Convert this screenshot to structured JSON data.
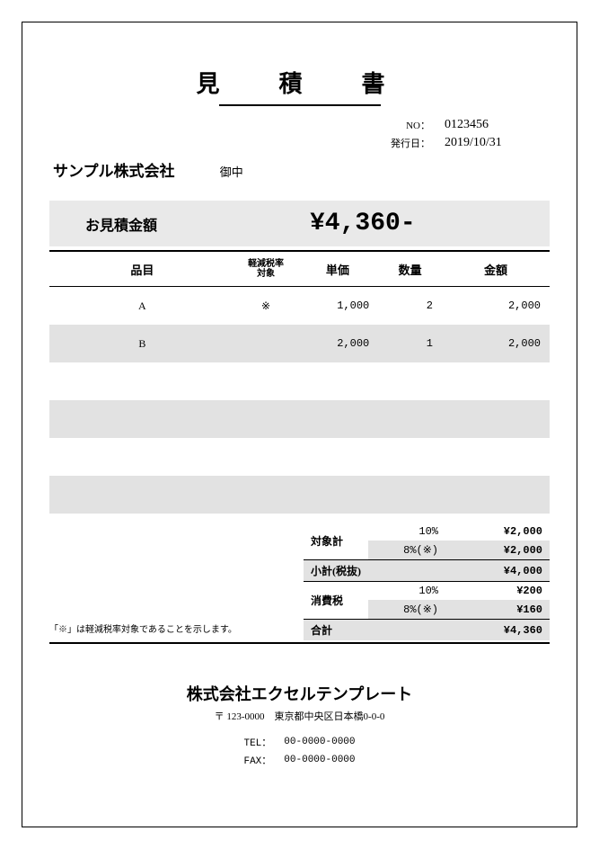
{
  "title": "見　積　書",
  "meta": {
    "no_label": "NO：",
    "no_value": "0123456",
    "date_label": "発行日：",
    "date_value": "2019/10/31"
  },
  "client": {
    "name": "サンプル株式会社",
    "suffix": "御中"
  },
  "quote_total": {
    "label": "お見積金額",
    "value": "¥4,360-"
  },
  "columns": {
    "item": "品目",
    "reduced": "軽減税率\n対象",
    "unit": "単価",
    "qty": "数量",
    "amount": "金額"
  },
  "rows": [
    {
      "item": "A",
      "reduced": "※",
      "unit": "1,000",
      "qty": "2",
      "amount": "2,000"
    },
    {
      "item": "B",
      "reduced": "",
      "unit": "2,000",
      "qty": "1",
      "amount": "2,000"
    },
    {
      "item": "",
      "reduced": "",
      "unit": "",
      "qty": "",
      "amount": ""
    },
    {
      "item": "",
      "reduced": "",
      "unit": "",
      "qty": "",
      "amount": ""
    },
    {
      "item": "",
      "reduced": "",
      "unit": "",
      "qty": "",
      "amount": ""
    },
    {
      "item": "",
      "reduced": "",
      "unit": "",
      "qty": "",
      "amount": ""
    }
  ],
  "note": "「※」は軽減税率対象であることを示します。",
  "summary": {
    "subtotal_label": "対象計",
    "sub10_rate": "10%",
    "sub10_amt": "¥2,000",
    "sub8_rate": "8%(※)",
    "sub8_amt": "¥2,000",
    "exsubtotal_label": "小計(税抜)",
    "exsubtotal_amt": "¥4,000",
    "tax_label": "消費税",
    "tax10_rate": "10%",
    "tax10_amt": "¥200",
    "tax8_rate": "8%(※)",
    "tax8_amt": "¥160",
    "total_label": "合計",
    "total_amt": "¥4,360"
  },
  "company": {
    "name": "株式会社エクセルテンプレート",
    "postal": "〒 123-0000　東京都中央区日本橋0-0-0",
    "tel_label": "TEL：",
    "tel": "00-0000-0000",
    "fax_label": "FAX：",
    "fax": "00-0000-0000"
  }
}
